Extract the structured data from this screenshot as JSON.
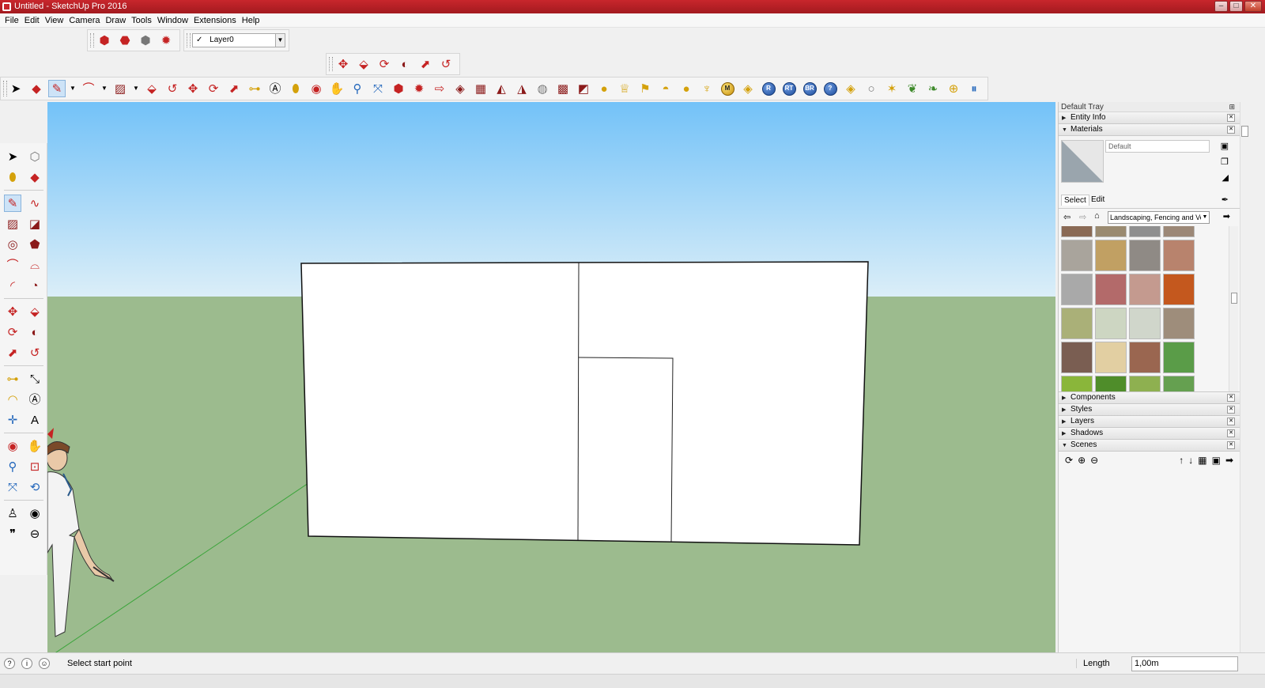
{
  "window": {
    "title": "Untitled - SketchUp Pro 2016",
    "controls": [
      "–",
      "□",
      "✕"
    ]
  },
  "menu": [
    "File",
    "Edit",
    "View",
    "Camera",
    "Draw",
    "Tools",
    "Window",
    "Extensions",
    "Help"
  ],
  "layer_toolbar": {
    "check": "✓",
    "layer_name": "Layer0"
  },
  "extension_icons": [
    "M",
    "RT",
    "R",
    "RT",
    "BR",
    "?"
  ],
  "tray": {
    "title": "Default Tray",
    "panels": {
      "entity_info": "Entity Info",
      "materials": "Materials",
      "components": "Components",
      "styles": "Styles",
      "layers": "Layers",
      "shadows": "Shadows",
      "scenes": "Scenes"
    },
    "material_name_placeholder": "Default",
    "tabs": {
      "select": "Select",
      "edit": "Edit"
    },
    "library": "Landscaping, Fencing and Vegetation",
    "swatch_colors": [
      "#8a6a55",
      "#9a8a70",
      "#8f8f8f",
      "#9c8877",
      "#a9a49c",
      "#c1a063",
      "#8f8a85",
      "#b8836d",
      "#a9a9a9",
      "#b36a6a",
      "#c49a8f",
      "#c4581e",
      "#aab078",
      "#cdd6c2",
      "#d0d6cb",
      "#9e8d7b",
      "#7a5e52",
      "#e2cfa2",
      "#9a6650",
      "#5a9c48",
      "#8ab63a",
      "#4f8d2a",
      "#8eb050",
      "#65a050"
    ]
  },
  "status": {
    "text": "Select start point",
    "measurement_label": "Length",
    "measurement_value": "1,00m"
  }
}
